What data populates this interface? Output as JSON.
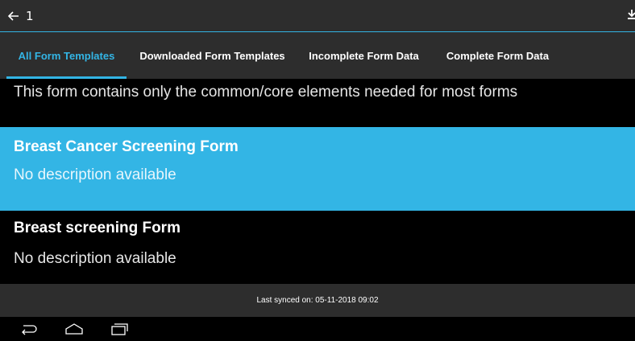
{
  "app_bar": {
    "back_icon": "arrow-left-icon",
    "title": "1",
    "download_icon": "download-icon"
  },
  "tabs": [
    {
      "label": "All Form Templates",
      "active": true
    },
    {
      "label": "Downloaded Form Templates",
      "active": false
    },
    {
      "label": "Incomplete Form Data",
      "active": false
    },
    {
      "label": "Complete Form Data",
      "active": false
    }
  ],
  "list": {
    "partial_description": "This form contains only the common/core elements needed for most forms",
    "items": [
      {
        "title": "Breast Cancer Screening Form",
        "description": "No description available",
        "selected": true
      },
      {
        "title": "Breast screening Form",
        "description": "No description available",
        "selected": false
      }
    ]
  },
  "sync": {
    "text": "Last synced on: 05-11-2018 09:02"
  },
  "nav": {
    "back": "nav-back-icon",
    "home": "nav-home-icon",
    "recents": "nav-recents-icon"
  },
  "colors": {
    "accent": "#33b5e5",
    "bar": "#2d2d2d",
    "background": "#000000"
  }
}
